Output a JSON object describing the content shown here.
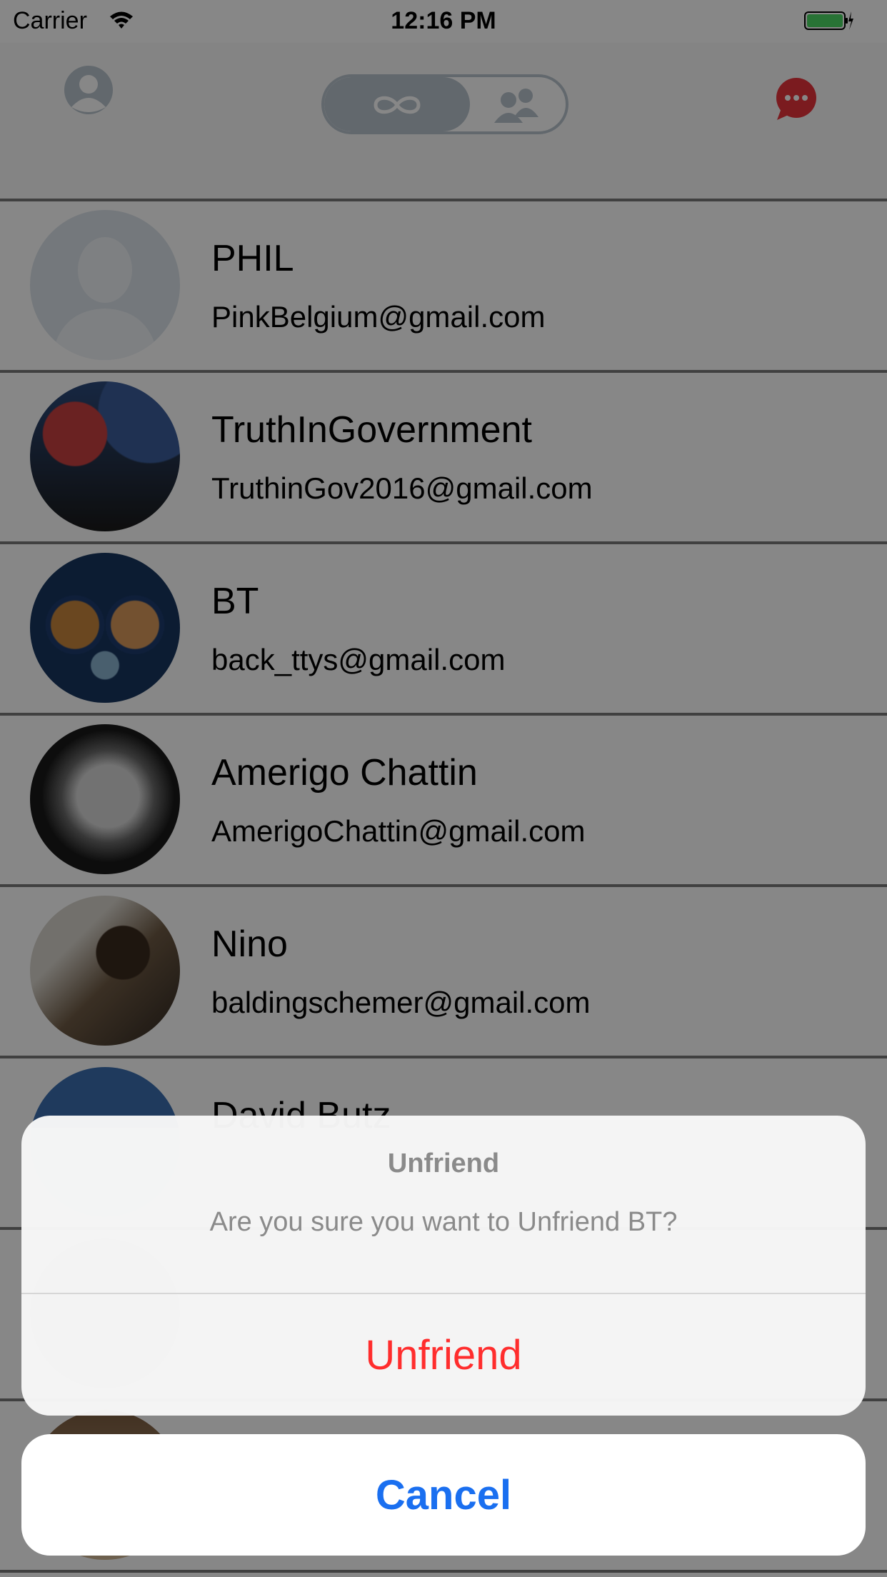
{
  "status_bar": {
    "carrier": "Carrier",
    "time": "12:16 PM"
  },
  "nav_bar": {
    "left_icon": "profile-icon",
    "segments": [
      "infinity-icon",
      "group-icon"
    ],
    "selected_segment": "infinity-icon",
    "right_icon": "chat-bubble-icon"
  },
  "contacts": [
    {
      "name": "PHIL",
      "email": "PinkBelgium@gmail.com"
    },
    {
      "name": "TruthInGovernment",
      "email": "TruthinGov2016@gmail.com"
    },
    {
      "name": "BT",
      "email": "back_ttys@gmail.com"
    },
    {
      "name": "Amerigo Chattin",
      "email": "AmerigoChattin@gmail.com"
    },
    {
      "name": "Nino",
      "email": "baldingschemer@gmail.com"
    },
    {
      "name": "David Butz",
      "email": ""
    }
  ],
  "action_sheet": {
    "title": "Unfriend",
    "message": "Are you sure you want to Unfriend BT?",
    "destructive_label": "Unfriend",
    "cancel_label": "Cancel"
  },
  "colors": {
    "destructive": "#ff2d2d",
    "cancel": "#1a6ff0",
    "chat_badge": "#e8333c",
    "battery": "#4cd964",
    "segment": "#b9c4ce"
  }
}
